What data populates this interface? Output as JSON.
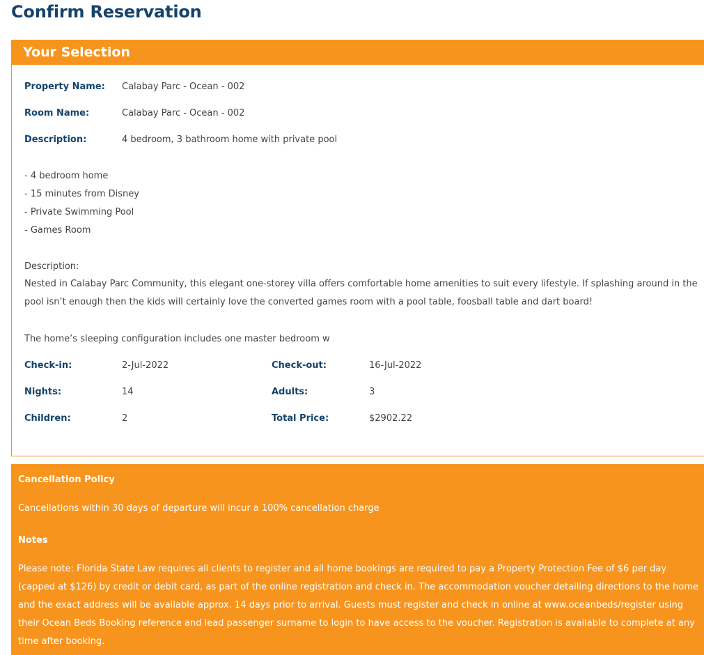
{
  "page": {
    "title": "Confirm Reservation"
  },
  "selection": {
    "header": "Your Selection",
    "property_label": "Property Name:",
    "property_value": "Calabay Parc - Ocean - 002",
    "room_label": "Room Name:",
    "room_value": "Calabay Parc - Ocean - 002",
    "description_label": "Description:",
    "description_value": "4 bedroom, 3 bathroom home with private pool",
    "features": [
      "- 4 bedroom home",
      "- 15 minutes from Disney",
      "- Private Swimming Pool",
      "- Games Room"
    ],
    "long_description_label": "Description:",
    "long_description": "Nested in Calabay Parc Community, this elegant one-storey villa offers comfortable home amenities to suit every lifestyle. If splashing around in the pool isn’t enough then the kids will certainly love the converted games room with a pool table, foosball table and dart board!",
    "sleeping_config": "The home’s sleeping configuration includes one master bedroom w",
    "checkin_label": "Check-in:",
    "checkin_value": "2-Jul-2022",
    "checkout_label": "Check-out:",
    "checkout_value": "16-Jul-2022",
    "nights_label": "Nights:",
    "nights_value": "14",
    "adults_label": "Adults:",
    "adults_value": "3",
    "children_label": "Children:",
    "children_value": "2",
    "total_label": "Total Price:",
    "total_value": "$2902.22"
  },
  "policy": {
    "cancellation_heading": "Cancellation Policy",
    "cancellation_text": "Cancellations within 30 days of departure will incur a 100% cancellation charge",
    "notes_heading": "Notes",
    "notes_text": "Please note: Florida State Law requires all clients to register and all home bookings are required to pay a Property Protection Fee of $6 per day (capped at $126) by credit or debit card, as part of the online registration and check in. The accommodation voucher detailing directions to the home and the exact address will be available approx. 14 days prior to arrival. Guests must register and check in online at www.oceanbeds/register using their Ocean Beds Booking reference and lead passenger surname to login to have access to the voucher. Registration is available to complete at any time after booking."
  },
  "colors": {
    "accent": "#f7941d",
    "title": "#15436b",
    "text": "#444444"
  }
}
